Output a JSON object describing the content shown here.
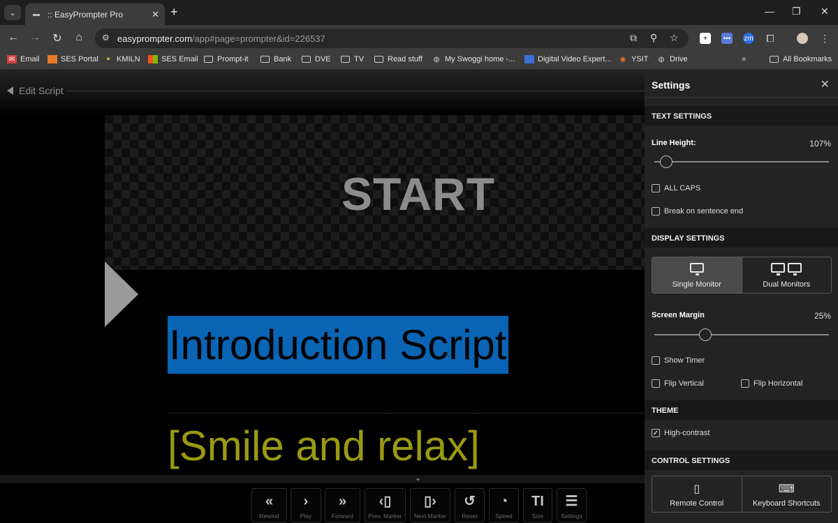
{
  "browser": {
    "tab_title": ":: EasyPrompter Pro",
    "url_main": "easyprompter.com",
    "url_rest": "/app#page=prompter&id=226537",
    "bookmarks": [
      "Email",
      "SES Portal",
      "KMILN",
      "SES Email",
      "Prompt-it",
      "Bank",
      "DVE",
      "TV",
      "Read stuff",
      "My Swoggi home -...",
      "Digital Video Expert...",
      "YSIT",
      "Drive"
    ],
    "all_bookmarks": "All Bookmarks",
    "more": "»"
  },
  "prompter": {
    "edit_script": "Edit Script",
    "start": "START",
    "intro": "Introduction Script",
    "smile": "[Smile and relax]",
    "highlight_color": "#0a64b4",
    "cue_color": "#9a9a12"
  },
  "controls": [
    {
      "label": "Rewind",
      "icon": "rewind-icon"
    },
    {
      "label": "Play",
      "icon": "play-icon"
    },
    {
      "label": "Forward",
      "icon": "forward-icon"
    },
    {
      "label": "Prev. Marker",
      "icon": "prev-marker-icon"
    },
    {
      "label": "Next Marker",
      "icon": "next-marker-icon"
    },
    {
      "label": "Reset",
      "icon": "reset-icon"
    },
    {
      "label": "Speed",
      "icon": "speed-icon"
    },
    {
      "label": "Size",
      "icon": "size-icon"
    },
    {
      "label": "Settings",
      "icon": "settings-sliders-icon"
    }
  ],
  "settings": {
    "title": "Settings",
    "text_settings": "TEXT SETTINGS",
    "line_height_label": "Line Height:",
    "line_height_value": "107%",
    "all_caps": "ALL CAPS",
    "break_sentence": "Break on sentence end",
    "display_settings": "DISPLAY SETTINGS",
    "single_monitor": "Single Monitor",
    "dual_monitors": "Dual Monitors",
    "screen_margin_label": "Screen Margin",
    "screen_margin_value": "25%",
    "show_timer": "Show Timer",
    "flip_vertical": "Flip Vertical",
    "flip_horizontal": "Flip Horizontal",
    "theme": "THEME",
    "high_contrast": "High-contrast",
    "control_settings": "CONTROL SETTINGS",
    "remote_control": "Remote Control",
    "keyboard_shortcuts": "Keyboard Shortcuts",
    "checked_mark": "✓"
  }
}
